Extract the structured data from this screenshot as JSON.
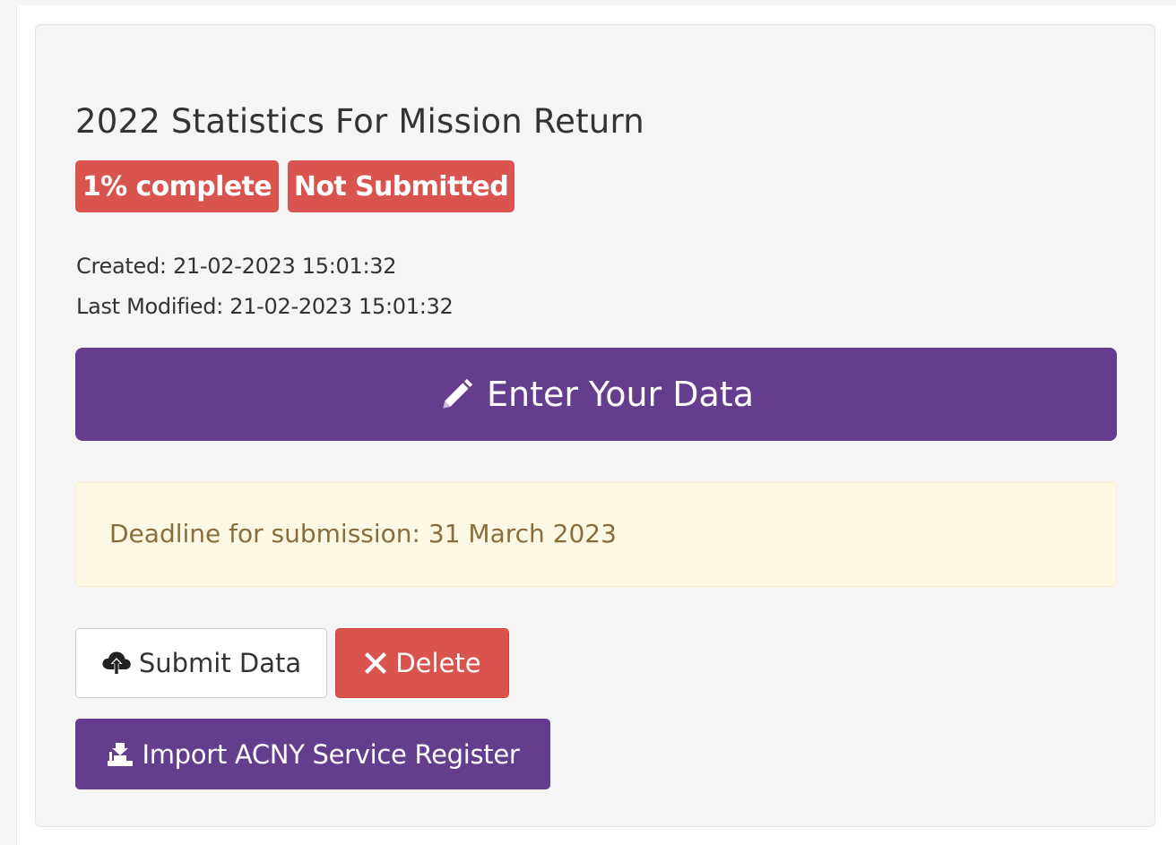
{
  "record": {
    "title": "2022 Statistics For Mission Return",
    "progress_badge": "1% complete",
    "progress_percent": 1,
    "status_badge": "Not Submitted",
    "created_text": "Created: 21-02-2023 15:01:32",
    "modified_text": "Last Modified: 21-02-2023 15:01:32"
  },
  "actions": {
    "enter_data_label": "Enter Your Data",
    "submit_label": "Submit Data",
    "delete_label": "Delete",
    "import_label": "Import ACNY Service Register"
  },
  "notice": {
    "deadline_text": "Deadline for submission: 31 March 2023"
  },
  "icons": {
    "enter": "pencil-icon",
    "submit": "cloud-upload-icon",
    "delete": "close-icon",
    "import": "import-icon"
  },
  "colors": {
    "primary": "#653d8f",
    "danger": "#d9534f",
    "warning_bg": "#fcf8e3",
    "warning_text": "#8a6d3b",
    "panel_bg": "#f5f5f5"
  }
}
